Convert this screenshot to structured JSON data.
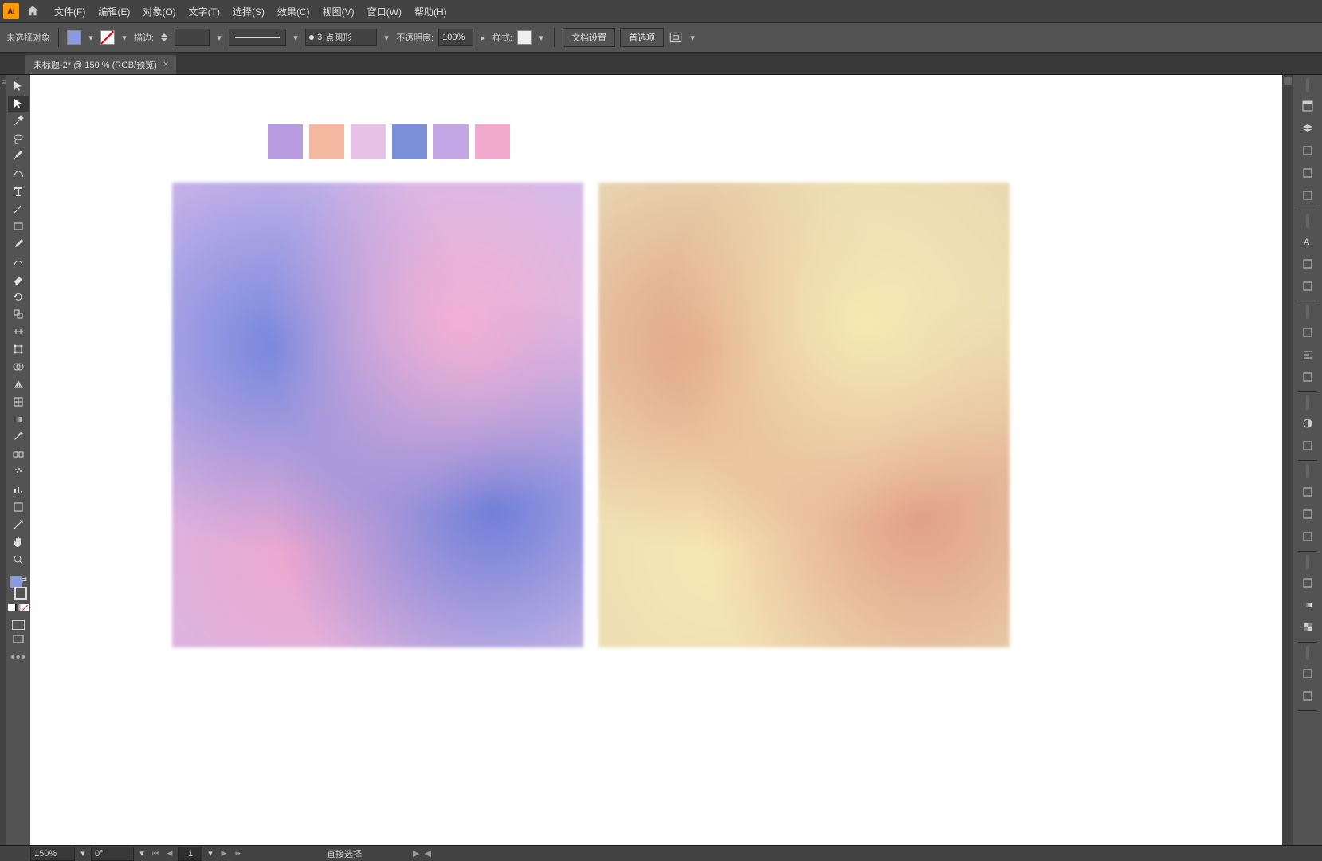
{
  "menu": {
    "items": [
      "文件(F)",
      "编辑(E)",
      "对象(O)",
      "文字(T)",
      "选择(S)",
      "效果(C)",
      "视图(V)",
      "窗口(W)",
      "帮助(H)"
    ]
  },
  "options": {
    "selection_label": "未选择对象",
    "stroke_label": "描边:",
    "stroke_weight": "",
    "brush_value": "3",
    "brush_label": "点圆形",
    "opacity_label": "不透明度:",
    "opacity_value": "100%",
    "style_label": "样式:",
    "doc_settings_btn": "文档设置",
    "prefs_btn": "首选项"
  },
  "tab": {
    "title": "未标题-2* @ 150 % (RGB/预览)"
  },
  "palette": {
    "colors": [
      "#b79de0",
      "#f2b8a0",
      "#e9c2ea",
      "#7c8fd8",
      "#c2a6e6",
      "#f1a9cd"
    ]
  },
  "status": {
    "zoom": "150%",
    "rotation": "0°",
    "artboard": "1",
    "tool_label": "直接选择"
  },
  "colors": {
    "fill": "#8a9be0"
  },
  "tools_left": [
    {
      "n": "selection-tool"
    },
    {
      "n": "direct-selection-tool",
      "sel": true
    },
    {
      "n": "magic-wand-tool"
    },
    {
      "n": "lasso-tool"
    },
    {
      "n": "pen-tool"
    },
    {
      "n": "curvature-tool"
    },
    {
      "n": "type-tool"
    },
    {
      "n": "line-tool"
    },
    {
      "n": "rectangle-tool"
    },
    {
      "n": "paintbrush-tool"
    },
    {
      "n": "shaper-tool"
    },
    {
      "n": "eraser-tool"
    },
    {
      "n": "rotate-tool"
    },
    {
      "n": "scale-tool"
    },
    {
      "n": "width-tool"
    },
    {
      "n": "free-transform-tool"
    },
    {
      "n": "shape-builder-tool"
    },
    {
      "n": "perspective-grid-tool"
    },
    {
      "n": "mesh-tool"
    },
    {
      "n": "gradient-tool"
    },
    {
      "n": "eyedropper-tool"
    },
    {
      "n": "blend-tool"
    },
    {
      "n": "symbol-sprayer-tool"
    },
    {
      "n": "column-graph-tool"
    },
    {
      "n": "artboard-tool"
    },
    {
      "n": "slice-tool"
    },
    {
      "n": "hand-tool"
    },
    {
      "n": "zoom-tool"
    }
  ],
  "panels_right_top": [
    {
      "n": "properties-panel-icon"
    },
    {
      "n": "layers-panel-icon"
    },
    {
      "n": "libraries-panel-icon"
    },
    {
      "n": "links-panel-icon"
    },
    {
      "n": "actions-panel-icon"
    }
  ],
  "panels_right_mid": [
    {
      "n": "character-panel-icon"
    },
    {
      "n": "paragraph-panel-icon"
    },
    {
      "n": "opentype-panel-icon"
    }
  ],
  "panels_right_b1": [
    {
      "n": "transform-panel-icon"
    },
    {
      "n": "align-panel-icon"
    },
    {
      "n": "pathfinder-panel-icon"
    }
  ],
  "panels_right_b2": [
    {
      "n": "color-panel-icon"
    },
    {
      "n": "color-guide-panel-icon"
    }
  ],
  "panels_right_b3": [
    {
      "n": "swatches-panel-icon"
    },
    {
      "n": "brushes-panel-icon"
    },
    {
      "n": "symbols-panel-icon"
    }
  ],
  "panels_right_b4": [
    {
      "n": "stroke-panel-icon"
    },
    {
      "n": "gradient-panel-icon"
    },
    {
      "n": "transparency-panel-icon"
    }
  ],
  "panels_right_b5": [
    {
      "n": "appearance-panel-icon"
    },
    {
      "n": "graphic-styles-panel-icon"
    }
  ]
}
